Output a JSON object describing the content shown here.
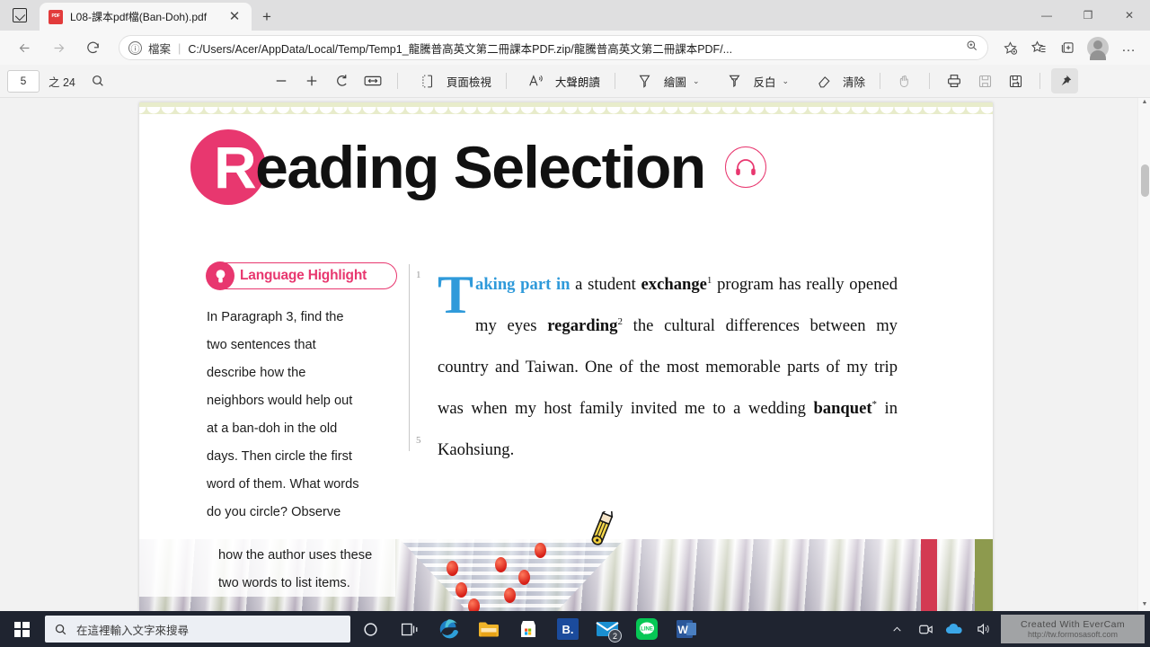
{
  "browser": {
    "tab": {
      "title": "L08-課本pdf檔(Ban-Doh).pdf",
      "favicon": "pdf-file-icon",
      "close": "✕"
    },
    "new_tab": "+",
    "window_controls": {
      "minimize": "—",
      "maximize": "❐",
      "close": "✕"
    },
    "nav": {
      "back": "←",
      "forward": "→",
      "reload": "⟳"
    },
    "address": {
      "info_icon": "ⓘ",
      "scheme_label": "檔案",
      "separator": "|",
      "url": "C:/Users/Acer/AppData/Local/Temp/Temp1_龍騰普高英文第二冊課本PDF.zip/龍騰普高英文第二冊課本PDF/...",
      "zoom_icon": "search-plus-icon"
    },
    "toolbar_right": {
      "add_favorite": "star-plus-icon",
      "favorites": "star-list-icon",
      "collections": "collections-icon",
      "profile": "avatar-icon",
      "settings": "…"
    }
  },
  "pdf_toolbar": {
    "current_page": "5",
    "page_of": "之 24",
    "total_pages": "24",
    "find": "search-icon",
    "zoom_out": "−",
    "zoom_in": "+",
    "rotate": "rotate-icon",
    "fit_page": "fit-page-icon",
    "page_view_icon": "page-view-icon",
    "page_view_label": "頁面檢視",
    "read_aloud_icon": "read-aloud-icon",
    "read_aloud_label": "大聲朗讀",
    "draw_icon": "pen-icon",
    "draw_label": "繪圖",
    "draw_caret": "⌄",
    "highlight_icon": "highlighter-icon",
    "highlight_label": "反白",
    "highlight_caret": "⌄",
    "erase_icon": "eraser-icon",
    "erase_label": "清除",
    "hand_icon": "hand-icon",
    "print_icon": "print-icon",
    "save_icon": "save-icon",
    "save_as_icon": "save-as-icon",
    "pin_icon": "pin-icon"
  },
  "document": {
    "heading": {
      "drop_letter": "R",
      "rest": "eading Selection",
      "audio_icon": "headphones-icon"
    },
    "language_highlight": {
      "icon": "lightbulb-icon",
      "title": "Language Highlight",
      "lines": [
        "In Paragraph 3, find the",
        "two sentences that",
        "describe how the",
        "neighbors would help out",
        "at a ban-doh in the old",
        "days. Then circle the first",
        "word of them. What words",
        "do you circle? Observe"
      ],
      "overlay_lines": [
        "how the author uses these",
        "two words to list items."
      ]
    },
    "line_numbers": [
      "1",
      "5"
    ],
    "passage": {
      "drop_cap": "T",
      "blue_run": "aking part in",
      "seg1": " a student ",
      "bold1": "exchange",
      "sup1": "1",
      "seg2": " program has really opened my eyes ",
      "bold2": "regarding",
      "sup2": "2",
      "seg3": " the cultural differences between my country and Taiwan. One of the most memorable parts of my trip was when my host family invited me to a wedding ",
      "bold3": "banquet",
      "sup3": "*",
      "seg4": " in Kaohsiung."
    },
    "photo_alt": "banquet-tent-with-red-lanterns"
  },
  "cursor": {
    "type": "pencil-drawing-cursor"
  },
  "scrollbar": {
    "up_arrow": "▲",
    "down_arrow": "▼"
  },
  "taskbar": {
    "start": "windows-logo-icon",
    "search_icon": "search-icon",
    "search_placeholder": "在這裡輸入文字來搜尋",
    "cortana": "cortana-circle-icon",
    "task_view": "task-view-icon",
    "apps": [
      {
        "name": "microsoft-edge",
        "label": "e"
      },
      {
        "name": "file-explorer",
        "label": ""
      },
      {
        "name": "microsoft-store",
        "label": ""
      },
      {
        "name": "bandizip",
        "label": "B."
      },
      {
        "name": "mail",
        "label": "",
        "badge": "2"
      },
      {
        "name": "line",
        "label": ""
      },
      {
        "name": "microsoft-word",
        "label": "W"
      }
    ],
    "tray": {
      "show_hidden": "^",
      "camera": "camera-icon",
      "onedrive": "cloud-icon",
      "volume": "speaker-icon"
    },
    "watermark": {
      "line1": "Created With EverCam",
      "line2": "http://tw.formosasoft.com"
    }
  },
  "colors": {
    "accent_pink": "#e8376f",
    "drop_cap_blue": "#2f9ada",
    "scallop_green": "#e8eccb",
    "taskbar": "#1f2430"
  }
}
